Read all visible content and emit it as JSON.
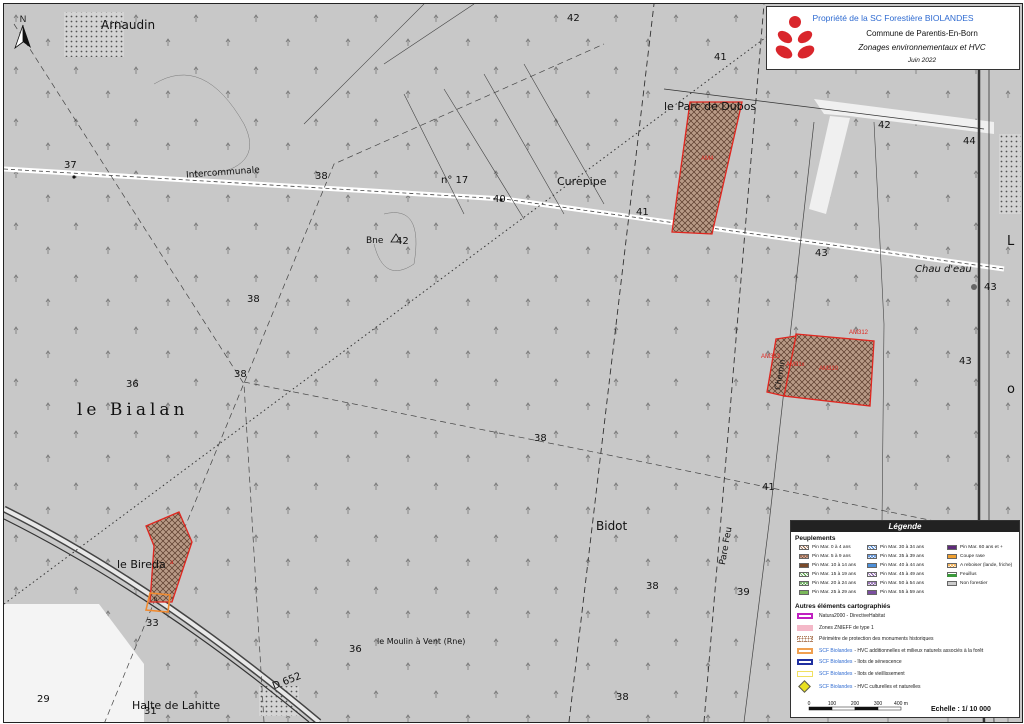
{
  "title_block": {
    "owner": "Propriété de la SC Forestière BIOLANDES",
    "commune": "Commune de Parentis-En-Born",
    "subject": "Zonages environnementaux et HVC",
    "date": "Juin 2022"
  },
  "map_labels": {
    "arnaudin": "Arnaudin",
    "parc_dubos": "le Parc de Dubos",
    "intercommunale": "Intercommunale",
    "n17": "n° 17",
    "curepipe": "Curepipe",
    "bne": "Bne",
    "bialan": "le Bialan",
    "bidot": "Bidot",
    "chateau_eau": "Chau d'eau",
    "bireda": "le Bireda",
    "moulin": "le Moulin à Vent (Rne)",
    "halte": "Halte de Lahitte",
    "pare_feu": "Pare Feu",
    "chemin": "Chemin",
    "d652": "D 652",
    "edge_letter": "L",
    "edge_letter2": "o"
  },
  "spot_heights": {
    "h42_top": "42",
    "h41_top": "41",
    "h42_right": "42",
    "h44": "44",
    "h37": "37",
    "h38_road": "38",
    "h40": "40",
    "h41_road": "41",
    "h42_bne": "42",
    "h43_road": "43",
    "h43_edge": "43",
    "h38_left": "38",
    "h36": "36",
    "h38_mid": "38",
    "h43_right": "43",
    "h38_center": "38",
    "h41_lower": "41",
    "h38_bottom": "38",
    "h39": "39",
    "h38_lowest": "38",
    "h33": "33",
    "h36_moulin": "36",
    "h29": "29",
    "h31": "31"
  },
  "parcels": {
    "parc_dubos": "AM4",
    "am313": "AM313",
    "am312": "AM312",
    "am31x": "AM31x",
    "am310": "AM310",
    "bireda_a": "a",
    "bireda_b": "b"
  },
  "legend": {
    "title": "Légende",
    "peuplements_title": "Peuplements",
    "peuplements": [
      {
        "label": "Pin Mar. 0 à 4 ans",
        "color": "#ffffff",
        "pattern": "hatch"
      },
      {
        "label": "Pin Mar. 5 à 9 ans",
        "color": "#d8b0a8",
        "pattern": "cross"
      },
      {
        "label": "Pin Mar. 10 à 14 ans",
        "color": "#7a4a2a",
        "pattern": "solid"
      },
      {
        "label": "Pin Mar. 15 à 19 ans",
        "color": "#ffffff",
        "pattern": "hatch-green"
      },
      {
        "label": "Pin Mar. 20 à 24 ans",
        "color": "#ffffff",
        "pattern": "cross-green"
      },
      {
        "label": "Pin Mar. 25 à 29 ans",
        "color": "#7bb85a",
        "pattern": "solid"
      },
      {
        "label": "Pin Mar. 30 à 34 ans",
        "color": "#ffffff",
        "pattern": "hatch-blue"
      },
      {
        "label": "Pin Mar. 35 à 39 ans",
        "color": "#ffffff",
        "pattern": "cross-blue"
      },
      {
        "label": "Pin Mar. 40 à 44 ans",
        "color": "#4c8fd9",
        "pattern": "solid"
      },
      {
        "label": "Pin Mar. 45 à 49 ans",
        "color": "#ffffff",
        "pattern": "hatch-purple"
      },
      {
        "label": "Pin Mar. 50 à 54 ans",
        "color": "#ffffff",
        "pattern": "cross-purple"
      },
      {
        "label": "Pin Mar. 55 à 59 ans",
        "color": "#7b4fa0",
        "pattern": "solid"
      },
      {
        "label": "Pin Mar. 60 ans et +",
        "color": "#5e2a7a",
        "pattern": "solid"
      },
      {
        "label": "Coupe rase",
        "color": "#f0a030",
        "pattern": "solid"
      },
      {
        "label": "A reboiser (lande, friche)",
        "color": "#ffffff",
        "pattern": "cross-orange"
      },
      {
        "label": "Feuillus",
        "color": "#3a9a3a",
        "pattern": "tree"
      },
      {
        "label": "Non forestier",
        "color": "#cccccc",
        "pattern": "solid"
      }
    ],
    "autres_title": "Autres éléments cartographiés",
    "autres": [
      {
        "prefix": "",
        "label": "Natura2000 - DirectiveHabitat",
        "color": "#c020c0",
        "kind": "outline"
      },
      {
        "prefix": "",
        "label": "Zones ZNIEFF de type 1",
        "color": "#f4b8c8",
        "kind": "fill"
      },
      {
        "prefix": "",
        "label": "Périmètre de protection des monuments historiques",
        "color": "#b08060",
        "kind": "dots"
      },
      {
        "prefix": "SCF Biolandes",
        "label": "- HVC additionnelles et milieux naturels associés à la forêt",
        "color": "#f0a050",
        "kind": "outline"
      },
      {
        "prefix": "SCF Biolandes",
        "label": "- îlots de sénescence",
        "color": "#2030a0",
        "kind": "outline"
      },
      {
        "prefix": "SCF Biolandes",
        "label": "- îlots de vieillissement",
        "color": "#f0e060",
        "kind": "outline-thin"
      },
      {
        "prefix": "SCF Biolandes",
        "label": "- HVC culturelles et naturelles",
        "color": "#e8e020",
        "kind": "diamond"
      }
    ],
    "scale_ticks": [
      "0",
      "100",
      "200",
      "300",
      "400 m"
    ],
    "scale_label": "Echelle : 1/ 10 000"
  },
  "colors": {
    "map_bg": "#c8c8c8",
    "parcel_outline": "#e0261f",
    "parcel_fill": "#b89a86",
    "bireda_outline": "#f08a30",
    "title_blue": "#2f6bd1",
    "logo_red": "#d9262c"
  },
  "icons": {
    "north_arrow": "north-arrow-icon",
    "logo": "biolandes-logo-icon"
  }
}
